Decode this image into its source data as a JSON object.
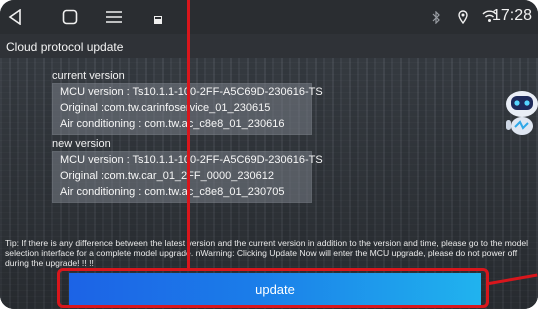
{
  "status_bar": {
    "time": "17:28",
    "icons": [
      "back-icon",
      "home-icon",
      "recent-apps-icon",
      "notification-icon",
      "bluetooth-icon",
      "location-icon",
      "wifi-icon"
    ]
  },
  "title_bar": {
    "title": "Cloud protocol update"
  },
  "current_version": {
    "label": "current version",
    "mcu": "MCU version : Ts10.1.1-100-2FF-A5C69D-230616-TS",
    "original": "Original :com.tw.carinfoservice_01_230615",
    "air": "Air conditioning :  com.tw.ac_c8e8_01_230616"
  },
  "new_version": {
    "label": "new version",
    "mcu": "MCU version : Ts10.1.1-100-2FF-A5C69D-230616-TS",
    "original": "Original :com.tw.car_01_2FF_0000_230612",
    "air": "Air conditioning :  com.tw.ac_c8e8_01_230705"
  },
  "tip": "Tip: If there is any difference between the latest version and the current version in addition to the version and time, please go to the model selection interface for a complete model upgrade.  nWarning: Clicking Update Now will enter the MCU upgrade, please do not power off during the upgrade! !! !!",
  "update_button": {
    "label": "update"
  },
  "colors": {
    "annotation_red": "#d9161c",
    "button_gradient_start": "#1c63e6",
    "button_gradient_end": "#20b3ee"
  }
}
